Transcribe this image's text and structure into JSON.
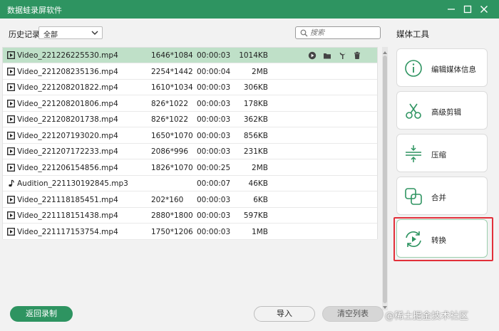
{
  "window": {
    "title": "数据蛙录屏软件",
    "brand_color": "#2e9461"
  },
  "filter": {
    "label": "历史记录",
    "selected": "全部",
    "search_placeholder": "搜索"
  },
  "files": [
    {
      "name": "Video_221226225530.mp4",
      "resolution": "1646*1084",
      "duration": "00:00:03",
      "size": "1014KB",
      "type": "video",
      "selected": true
    },
    {
      "name": "Video_221208235136.mp4",
      "resolution": "2254*1442",
      "duration": "00:00:04",
      "size": "2MB",
      "type": "video"
    },
    {
      "name": "Video_221208201822.mp4",
      "resolution": "1610*1034",
      "duration": "00:00:03",
      "size": "306KB",
      "type": "video"
    },
    {
      "name": "Video_221208201806.mp4",
      "resolution": "826*1022",
      "duration": "00:00:03",
      "size": "178KB",
      "type": "video"
    },
    {
      "name": "Video_221208201738.mp4",
      "resolution": "826*1022",
      "duration": "00:00:03",
      "size": "362KB",
      "type": "video"
    },
    {
      "name": "Video_221207193020.mp4",
      "resolution": "1650*1070",
      "duration": "00:00:03",
      "size": "856KB",
      "type": "video"
    },
    {
      "name": "Video_221207172233.mp4",
      "resolution": "2086*996",
      "duration": "00:00:03",
      "size": "231KB",
      "type": "video"
    },
    {
      "name": "Video_221206154856.mp4",
      "resolution": "1826*1070",
      "duration": "00:00:25",
      "size": "2MB",
      "type": "video"
    },
    {
      "name": "Audition_221130192845.mp3",
      "resolution": "",
      "duration": "00:00:07",
      "size": "46KB",
      "type": "audio"
    },
    {
      "name": "Video_221118185451.mp4",
      "resolution": "202*160",
      "duration": "00:00:03",
      "size": "6KB",
      "type": "video"
    },
    {
      "name": "Video_221118151438.mp4",
      "resolution": "2880*1800",
      "duration": "00:00:03",
      "size": "597KB",
      "type": "video"
    },
    {
      "name": "Video_221117153754.mp4",
      "resolution": "1750*1206",
      "duration": "00:00:03",
      "size": "1MB",
      "type": "video"
    }
  ],
  "row_actions": [
    "play-icon",
    "folder-icon",
    "tools-icon",
    "trash-icon"
  ],
  "buttons": {
    "back": "返回录制",
    "import": "导入",
    "clear": "清空列表"
  },
  "sidebar": {
    "title": "媒体工具",
    "tools": [
      {
        "label": "编辑媒体信息",
        "icon": "info-icon"
      },
      {
        "label": "高级剪辑",
        "icon": "scissors-icon"
      },
      {
        "label": "压缩",
        "icon": "compress-icon"
      },
      {
        "label": "合并",
        "icon": "merge-icon"
      },
      {
        "label": "转换",
        "icon": "convert-icon",
        "highlighted": true
      }
    ]
  },
  "watermark": "@稀土掘金技术社区",
  "highlight_color": "#e2303a"
}
